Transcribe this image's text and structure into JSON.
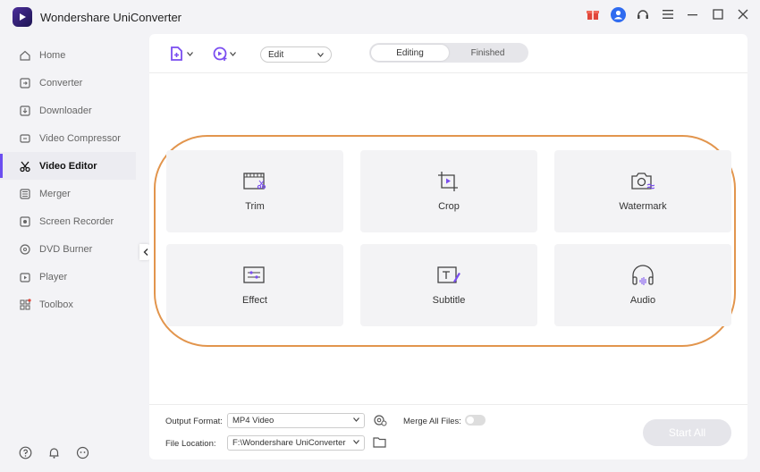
{
  "app": {
    "title": "Wondershare UniConverter"
  },
  "sidebar": {
    "items": [
      {
        "label": "Home",
        "icon": "home-icon"
      },
      {
        "label": "Converter",
        "icon": "converter-icon"
      },
      {
        "label": "Downloader",
        "icon": "download-icon"
      },
      {
        "label": "Video Compressor",
        "icon": "compress-icon"
      },
      {
        "label": "Video Editor",
        "icon": "scissors-icon",
        "active": true
      },
      {
        "label": "Merger",
        "icon": "merge-icon"
      },
      {
        "label": "Screen Recorder",
        "icon": "record-icon"
      },
      {
        "label": "DVD Burner",
        "icon": "disc-icon"
      },
      {
        "label": "Player",
        "icon": "play-icon"
      },
      {
        "label": "Toolbox",
        "icon": "grid-icon"
      }
    ]
  },
  "toolbar": {
    "edit_select": "Edit",
    "tabs": [
      {
        "label": "Editing",
        "active": true
      },
      {
        "label": "Finished",
        "active": false
      }
    ]
  },
  "cards": [
    {
      "label": "Trim",
      "icon": "trim-icon"
    },
    {
      "label": "Crop",
      "icon": "crop-icon"
    },
    {
      "label": "Watermark",
      "icon": "watermark-icon"
    },
    {
      "label": "Effect",
      "icon": "effect-icon"
    },
    {
      "label": "Subtitle",
      "icon": "subtitle-icon"
    },
    {
      "label": "Audio",
      "icon": "headphones-icon"
    }
  ],
  "footer": {
    "output_format_label": "Output Format:",
    "output_format_value": "MP4 Video",
    "file_location_label": "File Location:",
    "file_location_value": "F:\\Wondershare UniConverter",
    "merge_label": "Merge All Files:",
    "start_all_label": "Start All"
  },
  "colors": {
    "accent": "#6b4df0",
    "highlight": "#e2954d",
    "notification": "#e0463a"
  }
}
